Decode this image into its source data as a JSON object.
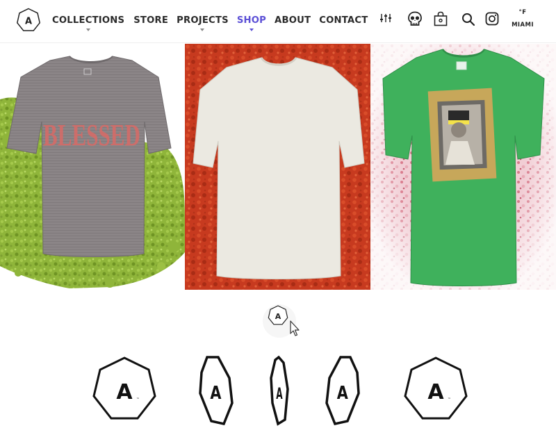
{
  "header": {
    "logo_letter": "A",
    "nav": [
      {
        "label": "COLLECTIONS",
        "has_dropdown": true
      },
      {
        "label": "STORE",
        "has_dropdown": false
      },
      {
        "label": "PROJECTS",
        "has_dropdown": true
      },
      {
        "label": "SHOP",
        "has_dropdown": true,
        "active": true
      },
      {
        "label": "ABOUT",
        "has_dropdown": false
      },
      {
        "label": "CONTACT",
        "has_dropdown": false
      }
    ],
    "tools": [
      "sliders-icon",
      "skull-icon",
      "shopping-bag-icon",
      "search-icon",
      "instagram-icon"
    ],
    "weather": {
      "unit": "°F",
      "city": "MIAMI"
    }
  },
  "products": [
    {
      "name": "tshirt-grey-blessed",
      "print_text": "BLESSED",
      "shirt_color": "#8c8688",
      "background": "green-powder"
    },
    {
      "name": "tshirt-white",
      "shirt_color": "#e9e7de",
      "background": "red-powder"
    },
    {
      "name": "tshirt-green-portrait",
      "shirt_color": "#3fb15c",
      "background": "pink-powder"
    }
  ],
  "logo_sequence": {
    "letter": "A",
    "tm": "™",
    "frames": 5
  },
  "colors": {
    "accent": "#5b4fd6",
    "text": "#2b2b2b"
  }
}
